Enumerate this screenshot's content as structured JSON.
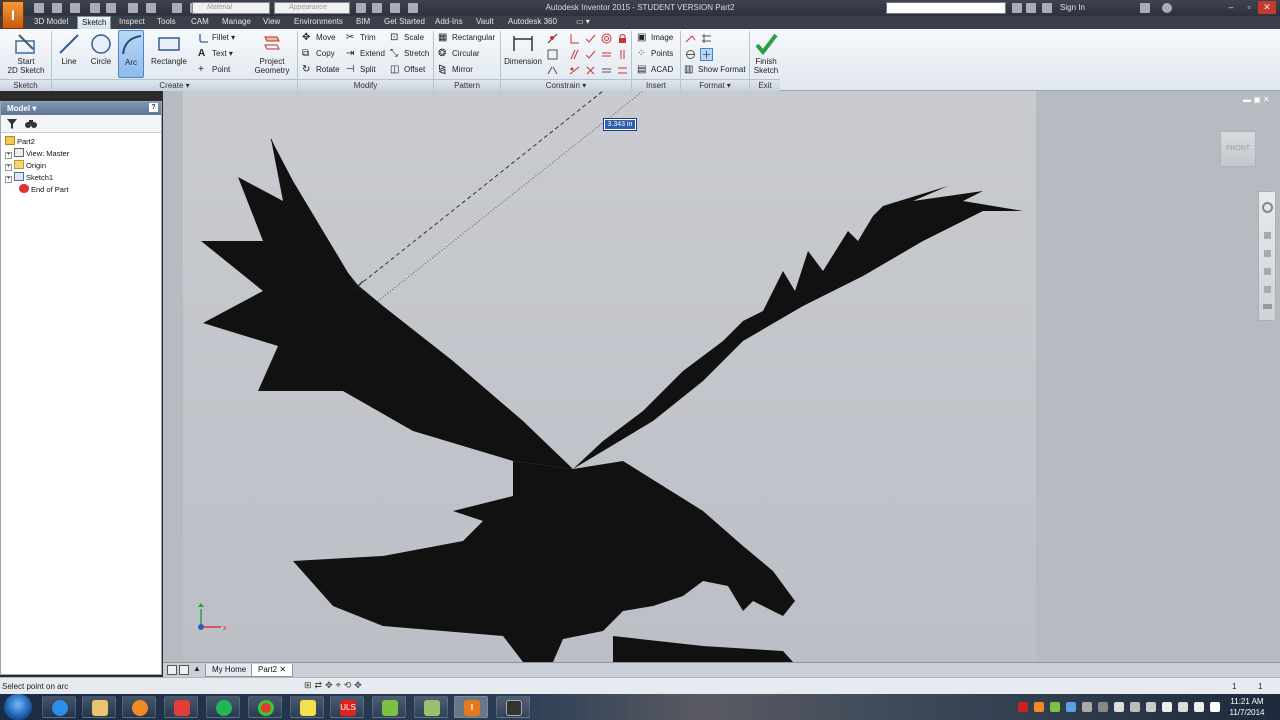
{
  "app": {
    "title": "Autodesk Inventor 2015 - STUDENT VERSION   Part2",
    "logo_letter": "I",
    "material_placeholder": "Material",
    "appearance_placeholder": "Appearance",
    "sign_in": "Sign In"
  },
  "menu_tabs": [
    "3D Model",
    "Sketch",
    "Inspect",
    "Tools",
    "CAM",
    "Manage",
    "View",
    "Environments",
    "BIM",
    "Get Started",
    "Add-Ins",
    "Vault",
    "Autodesk 360"
  ],
  "active_tab": "Sketch",
  "ribbon": {
    "sketch": {
      "start_label_1": "Start",
      "start_label_2": "2D Sketch",
      "panel": "Sketch"
    },
    "create": {
      "line": "Line",
      "circle": "Circle",
      "arc": "Arc",
      "rectangle": "Rectangle",
      "fillet": "Fillet",
      "text": "Text",
      "point": "Point",
      "project_1": "Project",
      "project_2": "Geometry",
      "panel": "Create ▾"
    },
    "modify": {
      "move": "Move",
      "copy": "Copy",
      "rotate": "Rotate",
      "trim": "Trim",
      "extend": "Extend",
      "split": "Split",
      "scale": "Scale",
      "stretch": "Stretch",
      "offset": "Offset",
      "panel": "Modify"
    },
    "pattern": {
      "rectangular": "Rectangular",
      "circular": "Circular",
      "mirror": "Mirror",
      "panel": "Pattern"
    },
    "constrain": {
      "dimension": "Dimension",
      "panel": "Constrain ▾"
    },
    "insert": {
      "image": "Image",
      "points": "Points",
      "acad": "ACAD",
      "panel": "Insert"
    },
    "format": {
      "show_format": "Show Format",
      "panel": "Format ▾"
    },
    "exit": {
      "finish_1": "Finish",
      "finish_2": "Sketch",
      "panel": "Exit"
    }
  },
  "browser": {
    "title": "Model ▾",
    "tree": [
      {
        "label": "Part2",
        "indent": 0,
        "icon": "part-icon"
      },
      {
        "label": "View: Master",
        "indent": 1,
        "icon": "view-icon"
      },
      {
        "label": "Origin",
        "indent": 1,
        "icon": "folder-icon"
      },
      {
        "label": "Sketch1",
        "indent": 1,
        "icon": "sketch-icon"
      },
      {
        "label": "End of Part",
        "indent": 1,
        "icon": "end-of-part-icon"
      }
    ]
  },
  "graphics": {
    "dimension_value": "3.343 in",
    "viewcube_label": "FRONT"
  },
  "doc_tabs": {
    "home": "My Home",
    "part": "Part2"
  },
  "status": {
    "message": "Select point on arc",
    "num1": "1",
    "num2": "1"
  },
  "taskbar": {
    "time": "11:21 AM",
    "date": "11/7/2014",
    "apps": [
      "ie-icon",
      "explorer-icon",
      "media-player-icon",
      "apps-icon",
      "spotify-icon",
      "chrome-icon",
      "notes-icon",
      "uls-icon",
      "pen-icon",
      "folder-icon",
      "inventor-icon",
      "media-icon"
    ]
  },
  "colors": {
    "accent": "#2f5fae",
    "ribbon_active": "#8ebbe9",
    "titlebar": "#2c313b",
    "silhouette": "#111111"
  }
}
